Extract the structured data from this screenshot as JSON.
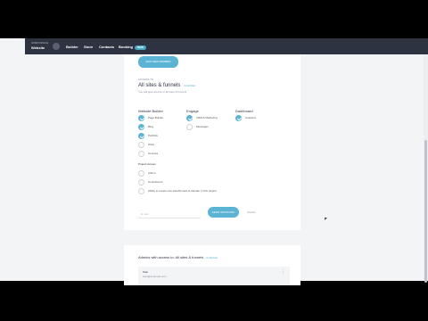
{
  "topnav": {
    "workspace_sub": "WORKSPACE",
    "workspace_name": "Website",
    "items": [
      "Builder",
      "Store",
      "Contacts",
      "Booking"
    ],
    "badge": "NEW"
  },
  "invite": {
    "add_button": "ADD NEW MEMBER",
    "access_label": "ACCESS TO",
    "access_title": "All sites & funnels",
    "change_link": "CHANGE",
    "access_desc": "You will give access to all sites & funnels",
    "columns": [
      {
        "title": "Website Builder",
        "options": [
          {
            "label": "Page Builder",
            "checked": true
          },
          {
            "label": "Blog",
            "checked": true
          },
          {
            "label": "Portfolio",
            "checked": true
          },
          {
            "label": "Store",
            "checked": false
          },
          {
            "label": "Courses",
            "checked": false
          }
        ]
      },
      {
        "title": "Engage",
        "options": [
          {
            "label": "CRM & Marketing",
            "checked": true
          },
          {
            "label": "Messages",
            "checked": false
          }
        ]
      },
      {
        "title": "Dashboard",
        "options": [
          {
            "label": "Analytics",
            "checked": true
          }
        ]
      }
    ],
    "project_access_label": "Project Access",
    "project_access_options": [
      {
        "label": "Admin",
        "checked": false
      },
      {
        "label": "Contributors",
        "checked": false
      },
      {
        "label": "Ability to create new sites/funnels & transfer in this project",
        "checked": false
      }
    ],
    "email_placeholder": "E-mail",
    "send_button": "SEND INVITATION",
    "cancel": "Cancel"
  },
  "admins": {
    "title": "Admins with access to: All sites & funnels",
    "change_link": "CHANGE",
    "row_name": "Stan",
    "row_email": "stan@example.com"
  },
  "colors": {
    "accent": "#5bb4d3",
    "nav": "#2e3342"
  }
}
